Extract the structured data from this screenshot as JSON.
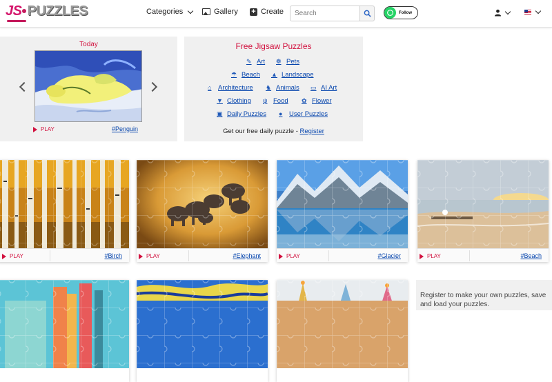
{
  "header": {
    "logo_left": "JS",
    "logo_right": "PUZZLES",
    "nav": {
      "categories": "Categories",
      "gallery": "Gallery",
      "create": "Create"
    },
    "search_placeholder": "Search",
    "whatsapp_label": "Follow"
  },
  "today": {
    "title": "Today",
    "play": "PLAY",
    "tag": "#Penguin"
  },
  "free": {
    "title": "Free Jigsaw Puzzles",
    "categories": {
      "art": "Art",
      "pets": "Pets",
      "beach": "Beach",
      "landscape": "Landscape",
      "architecture": "Architecture",
      "animals": "Animals",
      "ai_art": "AI Art",
      "clothing": "Clothing",
      "food": "Food",
      "flower": "Flower",
      "daily": "Daily Puzzles",
      "user": "User Puzzles"
    },
    "cta_text": "Get our free daily puzzle - ",
    "cta_link": "Register"
  },
  "puzzles": [
    {
      "play": "PLAY",
      "tag": "#Birch"
    },
    {
      "play": "PLAY",
      "tag": "#Elephant"
    },
    {
      "play": "PLAY",
      "tag": "#Glacier"
    },
    {
      "play": "PLAY",
      "tag": "#Beach"
    }
  ],
  "register_box": {
    "text": "Register to make your own puzzles, save and load your puzzles."
  },
  "colors": {
    "accent_red": "#d2123f",
    "link_blue": "#0645ad",
    "icon_blue": "#1e58b8",
    "whatsapp_green": "#25d366",
    "panel_bg": "#f0f0f0"
  }
}
